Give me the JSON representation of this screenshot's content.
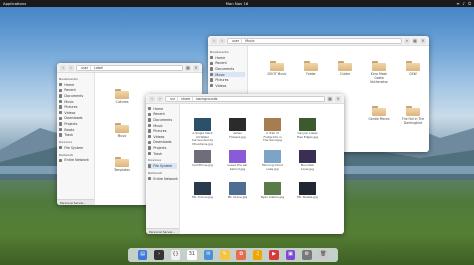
{
  "topbar": {
    "activities": "Applications",
    "clock": "Mon Nov 16",
    "tray": [
      "≡",
      "♪",
      "⏻"
    ]
  },
  "colors": {
    "folder": "#dcb57e",
    "accent": "#3d7bd8",
    "selection": "#d9e6f5"
  },
  "win_back_right": {
    "crumbs": [
      "user",
      "Music"
    ],
    "sidebar": {
      "heading": "Bookmarks",
      "items": [
        "Home",
        "Recent",
        "Documents",
        "Music",
        "Pictures",
        "Videos"
      ]
    },
    "folders": [
      "DOOT Music",
      "Folder",
      "Clutter",
      "Kirra Mash Gaeta Nutherwise",
      "GSW",
      "",
      "",
      "",
      "Gentle Pieces",
      "The Fall in The Darkingbird"
    ]
  },
  "win_back_left": {
    "crumbs": [
      "user",
      "Label"
    ],
    "sidebar": {
      "heading": "Bookmarks",
      "items": [
        "Home",
        "Recent",
        "Documents",
        "Music",
        "Pictures",
        "Videos",
        "Downloads",
        "Projects",
        "Books",
        "Trash",
        "File System"
      ],
      "devices": "Devices",
      "network_heading": "Network",
      "network": [
        "Entire Network"
      ],
      "footer": "Personal Server..."
    },
    "folders": [
      "Cultures",
      "Music",
      "Templates"
    ]
  },
  "win_front": {
    "crumbs": [
      "usr",
      "share",
      "backgrounds"
    ],
    "sidebar": {
      "items": [
        "Home",
        "Recent",
        "Documents",
        "Music",
        "Pictures",
        "Videos",
        "Downloads",
        "Projects",
        "Trash"
      ],
      "devices_heading": "Devices",
      "devices": [
        "File System"
      ],
      "network_heading": "Network",
      "network": [
        "Entire Network"
      ],
      "footer": "Personal Server..."
    },
    "files": [
      {
        "name": "A Single Slack All Water Surrounded by Mountains.jpg",
        "color": "#2c4f6a"
      },
      {
        "name": "Ashes Flowers.jpg",
        "color": "#2b2b2b"
      },
      {
        "name": "A Trail of Footprints in The Sand.jpg",
        "color": "#a67d4e"
      },
      {
        "name": "Canyon Lakes Tree Edges.jpg",
        "color": "#3b5a2e"
      },
      {
        "name": "Cell Phone.jpg",
        "color": "#6e6e7a"
      },
      {
        "name": "Leave the ear behind.jpg",
        "color": "#8a5bd6"
      },
      {
        "name": "Morning Cloud Lake.jpg",
        "color": "#7da3c7"
      },
      {
        "name": "Mountain Lines.jpg",
        "color": "#3a2f52"
      },
      {
        "name": "Mt. Crocus.jpg",
        "color": "#2a3a4e"
      },
      {
        "name": "Mt. Grace.jpg",
        "color": "#4d6e91"
      },
      {
        "name": "Ryan Adams.jpg",
        "color": "#5b7a4a"
      },
      {
        "name": "Mt. Shasta.jpg",
        "color": "#1f2733"
      }
    ]
  },
  "dock": [
    {
      "name": "files",
      "color": "#3d7bd8",
      "glyph": "▤"
    },
    {
      "name": "terminal",
      "color": "#333333",
      "glyph": "›"
    },
    {
      "name": "code",
      "color": "#f2f2f2",
      "glyph": "{}"
    },
    {
      "name": "calendar",
      "color": "#ffffff",
      "glyph": "31"
    },
    {
      "name": "mail",
      "color": "#4a90d9",
      "glyph": "✉"
    },
    {
      "name": "notes",
      "color": "#f5c542",
      "glyph": "✎"
    },
    {
      "name": "photos",
      "color": "#e86b4f",
      "glyph": "✿"
    },
    {
      "name": "music",
      "color": "#f0a500",
      "glyph": "♫"
    },
    {
      "name": "videos",
      "color": "#d63a3a",
      "glyph": "▶"
    },
    {
      "name": "store",
      "color": "#7c4ad6",
      "glyph": "▣"
    },
    {
      "name": "settings",
      "color": "#7a7a7a",
      "glyph": "⚙"
    },
    {
      "name": "trash",
      "color": "#c8c8c8",
      "glyph": "🗑"
    }
  ]
}
